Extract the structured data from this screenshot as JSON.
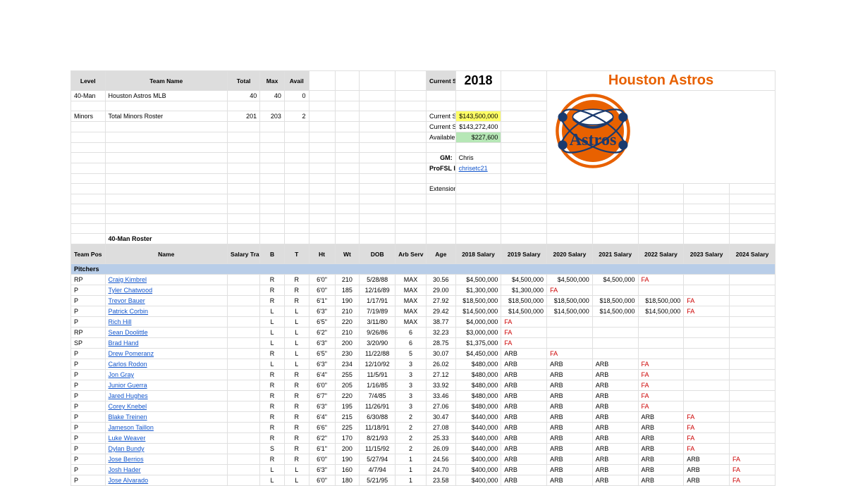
{
  "header": {
    "cols": [
      "Level",
      "Team Name",
      "Total",
      "Max",
      "Avail"
    ],
    "rows": [
      {
        "level": "40-Man",
        "name": "Houston Astros MLB",
        "total": "40",
        "max": "40",
        "avail": "0"
      },
      {
        "level": "Minors",
        "name": "Total Minors Roster",
        "total": "201",
        "max": "203",
        "avail": "2"
      }
    ],
    "season_label": "Current Season",
    "year": "2018",
    "title": "Houston Astros",
    "info": [
      {
        "k": "Current Season C",
        "v": "$143,500,000",
        "cls": "yellow"
      },
      {
        "k": "Current Season S",
        "v": "$143,272,400",
        "cls": ""
      },
      {
        "k": "Available",
        "v": "$227,600",
        "cls": "green"
      }
    ],
    "gm_label": "GM:",
    "gm": "Chris",
    "pro_label": "ProFSL ID:",
    "pro": "chrisetc21",
    "ext_label": "Extensions"
  },
  "roster": {
    "title": "40-Man Roster",
    "cols": [
      "Team Pos",
      "Name",
      "Salary Travel",
      "B",
      "T",
      "Ht",
      "Wt",
      "DOB",
      "Arb Serv",
      "Age",
      "2018 Salary",
      "2019 Salary",
      "2020 Salary",
      "2021 Salary",
      "2022 Salary",
      "2023 Salary",
      "2024 Salary"
    ],
    "section": "Pitchers",
    "rows": [
      {
        "pos": "RP",
        "name": "Craig Kimbrel",
        "b": "R",
        "t": "R",
        "ht": "6'0\"",
        "wt": "210",
        "dob": "5/28/88",
        "arb": "MAX",
        "age": "30.56",
        "s": [
          "$4,500,000",
          "$4,500,000",
          "$4,500,000",
          "$4,500,000",
          "FA",
          "",
          ""
        ]
      },
      {
        "pos": "P",
        "name": "Tyler Chatwood",
        "b": "R",
        "t": "R",
        "ht": "6'0\"",
        "wt": "185",
        "dob": "12/16/89",
        "arb": "MAX",
        "age": "29.00",
        "s": [
          "$1,300,000",
          "$1,300,000",
          "FA",
          "",
          "",
          "",
          ""
        ]
      },
      {
        "pos": "P",
        "name": "Trevor Bauer",
        "b": "R",
        "t": "R",
        "ht": "6'1\"",
        "wt": "190",
        "dob": "1/17/91",
        "arb": "MAX",
        "age": "27.92",
        "s": [
          "$18,500,000",
          "$18,500,000",
          "$18,500,000",
          "$18,500,000",
          "$18,500,000",
          "FA",
          ""
        ]
      },
      {
        "pos": "P",
        "name": "Patrick Corbin",
        "b": "L",
        "t": "L",
        "ht": "6'3\"",
        "wt": "210",
        "dob": "7/19/89",
        "arb": "MAX",
        "age": "29.42",
        "s": [
          "$14,500,000",
          "$14,500,000",
          "$14,500,000",
          "$14,500,000",
          "$14,500,000",
          "FA",
          ""
        ]
      },
      {
        "pos": "P",
        "name": "Rich Hill",
        "b": "L",
        "t": "L",
        "ht": "6'5\"",
        "wt": "220",
        "dob": "3/11/80",
        "arb": "MAX",
        "age": "38.77",
        "s": [
          "$4,000,000",
          "FA",
          "",
          "",
          "",
          "",
          ""
        ]
      },
      {
        "pos": "RP",
        "name": "Sean Doolittle",
        "b": "L",
        "t": "L",
        "ht": "6'2\"",
        "wt": "210",
        "dob": "9/26/86",
        "arb": "6",
        "age": "32.23",
        "s": [
          "$3,000,000",
          "FA",
          "",
          "",
          "",
          "",
          ""
        ]
      },
      {
        "pos": "SP",
        "name": "Brad Hand",
        "b": "L",
        "t": "L",
        "ht": "6'3\"",
        "wt": "200",
        "dob": "3/20/90",
        "arb": "6",
        "age": "28.75",
        "s": [
          "$1,375,000",
          "FA",
          "",
          "",
          "",
          "",
          ""
        ]
      },
      {
        "pos": "P",
        "name": "Drew Pomeranz",
        "b": "R",
        "t": "L",
        "ht": "6'5\"",
        "wt": "230",
        "dob": "11/22/88",
        "arb": "5",
        "age": "30.07",
        "s": [
          "$4,450,000",
          "ARB",
          "FA",
          "",
          "",
          "",
          ""
        ]
      },
      {
        "pos": "P",
        "name": "Carlos Rodon",
        "b": "L",
        "t": "L",
        "ht": "6'3\"",
        "wt": "234",
        "dob": "12/10/92",
        "arb": "3",
        "age": "26.02",
        "s": [
          "$480,000",
          "ARB",
          "ARB",
          "ARB",
          "FA",
          "",
          ""
        ]
      },
      {
        "pos": "P",
        "name": "Jon Gray",
        "b": "R",
        "t": "R",
        "ht": "6'4\"",
        "wt": "255",
        "dob": "11/5/91",
        "arb": "3",
        "age": "27.12",
        "s": [
          "$480,000",
          "ARB",
          "ARB",
          "ARB",
          "FA",
          "",
          ""
        ]
      },
      {
        "pos": "P",
        "name": "Junior Guerra",
        "b": "R",
        "t": "R",
        "ht": "6'0\"",
        "wt": "205",
        "dob": "1/16/85",
        "arb": "3",
        "age": "33.92",
        "s": [
          "$480,000",
          "ARB",
          "ARB",
          "ARB",
          "FA",
          "",
          ""
        ]
      },
      {
        "pos": "P",
        "name": "Jared Hughes",
        "b": "R",
        "t": "R",
        "ht": "6'7\"",
        "wt": "220",
        "dob": "7/4/85",
        "arb": "3",
        "age": "33.46",
        "s": [
          "$480,000",
          "ARB",
          "ARB",
          "ARB",
          "FA",
          "",
          ""
        ]
      },
      {
        "pos": "P",
        "name": "Corey Knebel",
        "b": "R",
        "t": "R",
        "ht": "6'3\"",
        "wt": "195",
        "dob": "11/26/91",
        "arb": "3",
        "age": "27.06",
        "s": [
          "$480,000",
          "ARB",
          "ARB",
          "ARB",
          "FA",
          "",
          ""
        ]
      },
      {
        "pos": "P",
        "name": "Blake Treinen",
        "b": "R",
        "t": "R",
        "ht": "6'4\"",
        "wt": "215",
        "dob": "6/30/88",
        "arb": "2",
        "age": "30.47",
        "s": [
          "$440,000",
          "ARB",
          "ARB",
          "ARB",
          "ARB",
          "FA",
          ""
        ]
      },
      {
        "pos": "P",
        "name": "Jameson Taillon",
        "b": "R",
        "t": "R",
        "ht": "6'6\"",
        "wt": "225",
        "dob": "11/18/91",
        "arb": "2",
        "age": "27.08",
        "s": [
          "$440,000",
          "ARB",
          "ARB",
          "ARB",
          "ARB",
          "FA",
          ""
        ]
      },
      {
        "pos": "P",
        "name": "Luke Weaver",
        "b": "R",
        "t": "R",
        "ht": "6'2\"",
        "wt": "170",
        "dob": "8/21/93",
        "arb": "2",
        "age": "25.33",
        "s": [
          "$440,000",
          "ARB",
          "ARB",
          "ARB",
          "ARB",
          "FA",
          ""
        ]
      },
      {
        "pos": "P",
        "name": "Dylan Bundy",
        "b": "S",
        "t": "R",
        "ht": "6'1\"",
        "wt": "200",
        "dob": "11/15/92",
        "arb": "2",
        "age": "26.09",
        "s": [
          "$440,000",
          "ARB",
          "ARB",
          "ARB",
          "ARB",
          "FA",
          ""
        ]
      },
      {
        "pos": "P",
        "name": "Jose Berrios",
        "b": "R",
        "t": "R",
        "ht": "6'0\"",
        "wt": "190",
        "dob": "5/27/94",
        "arb": "1",
        "age": "24.56",
        "s": [
          "$400,000",
          "ARB",
          "ARB",
          "ARB",
          "ARB",
          "ARB",
          "FA"
        ]
      },
      {
        "pos": "P",
        "name": "Josh Hader",
        "b": "L",
        "t": "L",
        "ht": "6'3\"",
        "wt": "160",
        "dob": "4/7/94",
        "arb": "1",
        "age": "24.70",
        "s": [
          "$400,000",
          "ARB",
          "ARB",
          "ARB",
          "ARB",
          "ARB",
          "FA"
        ]
      },
      {
        "pos": "P",
        "name": "Jose Alvarado",
        "b": "L",
        "t": "L",
        "ht": "6'0\"",
        "wt": "180",
        "dob": "5/21/95",
        "arb": "1",
        "age": "23.58",
        "s": [
          "$400,000",
          "ARB",
          "ARB",
          "ARB",
          "ARB",
          "ARB",
          "FA"
        ]
      }
    ]
  }
}
